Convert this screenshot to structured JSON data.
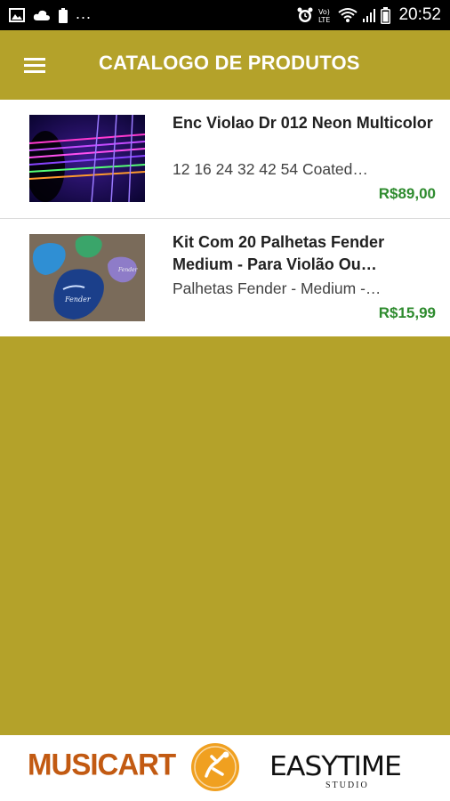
{
  "status_bar": {
    "time": "20:52",
    "overflow_indicator": "...",
    "icons_left": [
      "image-icon",
      "cloud-icon",
      "battery-small-icon"
    ],
    "icons_right": [
      "alarm-icon",
      "volte-icon",
      "wifi-icon",
      "signal-icon",
      "battery-icon"
    ]
  },
  "app_bar": {
    "title": "CATALOGO DE PRODUTOS",
    "menu_icon": "menu-icon",
    "background": "#b4a22a"
  },
  "products": [
    {
      "title": "Enc Violao Dr 012 Neon Multicolor",
      "description": "12 16 24 32 42 54 Coated…",
      "price": "R$89,00",
      "image": "guitar-strings-neon-image"
    },
    {
      "title": "Kit Com 20 Palhetas Fender Medium - Para Violão Ou…",
      "description": "Palhetas Fender - Medium -…",
      "price": "R$15,99",
      "image": "fender-picks-image"
    }
  ],
  "footer": {
    "brand_left": "MUSICART",
    "brand_right": "EASYTIME",
    "brand_right_sub": "STUDIO"
  },
  "colors": {
    "accent": "#b4a22a",
    "price": "#2e8b2e",
    "musicart": "#c25a12",
    "logo_orange": "#f0a020"
  }
}
